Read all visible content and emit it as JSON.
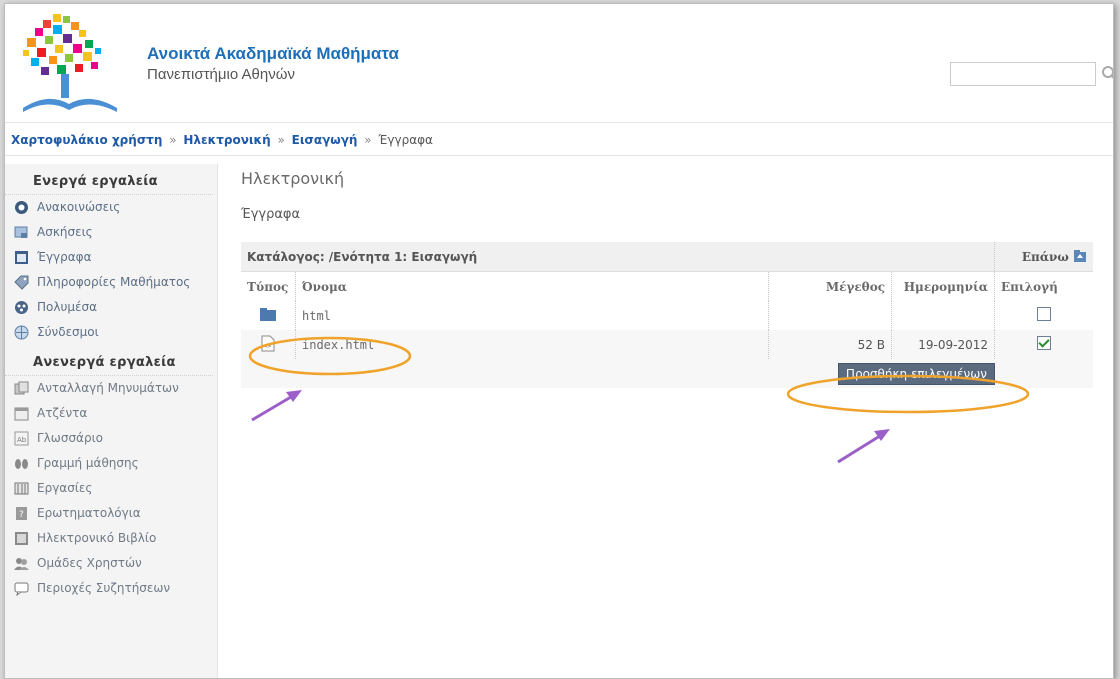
{
  "header": {
    "site_title": "Ανοικτά Ακαδημαϊκά Μαθήματα",
    "site_subtitle": "Πανεπιστήμιο Αθηνών",
    "search_value": ""
  },
  "breadcrumb": {
    "items": [
      "Χαρτοφυλάκιο χρήστη",
      "Ηλεκτρονική",
      "Εισαγωγή"
    ],
    "current": "Έγγραφα",
    "separator": "»"
  },
  "sidebar": {
    "active_heading": "Ενεργά εργαλεία",
    "active_items": [
      {
        "label": "Ανακοινώσεις",
        "icon": "announcements-icon"
      },
      {
        "label": "Ασκήσεις",
        "icon": "exercises-icon"
      },
      {
        "label": "Έγγραφα",
        "icon": "documents-icon"
      },
      {
        "label": "Πληροφορίες Μαθήματος",
        "icon": "course-info-icon"
      },
      {
        "label": "Πολυμέσα",
        "icon": "multimedia-icon"
      },
      {
        "label": "Σύνδεσμοι",
        "icon": "links-icon"
      }
    ],
    "inactive_heading": "Ανενεργά εργαλεία",
    "inactive_items": [
      {
        "label": "Ανταλλαγή Μηνυμάτων",
        "icon": "messages-icon"
      },
      {
        "label": "Ατζέντα",
        "icon": "calendar-icon"
      },
      {
        "label": "Γλωσσάριο",
        "icon": "glossary-icon"
      },
      {
        "label": "Γραμμή μάθησης",
        "icon": "learning-path-icon"
      },
      {
        "label": "Εργασίες",
        "icon": "assignments-icon"
      },
      {
        "label": "Ερωτηματολόγια",
        "icon": "questionnaire-icon"
      },
      {
        "label": "Ηλεκτρονικό Βιβλίο",
        "icon": "ebook-icon"
      },
      {
        "label": "Ομάδες Χρηστών",
        "icon": "user-groups-icon"
      },
      {
        "label": "Περιοχές Συζητήσεων",
        "icon": "forum-icon"
      }
    ]
  },
  "main": {
    "course_title": "Ηλεκτρονική",
    "section_title": "Έγγραφα",
    "catalog_label": "Κατάλογος: /Ενότητα 1: Εισαγωγή",
    "up_label": "Επάνω",
    "columns": [
      "Τύπος",
      "Όνομα",
      "Μέγεθος",
      "Ημερομηνία",
      "Επιλογή"
    ],
    "rows": [
      {
        "type": "folder",
        "name": "html",
        "size": "",
        "date": "",
        "checked": false
      },
      {
        "type": "file",
        "name": "index.html",
        "size": "52 B",
        "date": "19-09-2012",
        "checked": true
      }
    ],
    "add_selected_label": "Προσθήκη επιλεγμένων"
  },
  "colors": {
    "accent": "#1f6fb8",
    "annotation_ring": "#f0a32a",
    "annotation_arrow": "#9b5fc7"
  }
}
